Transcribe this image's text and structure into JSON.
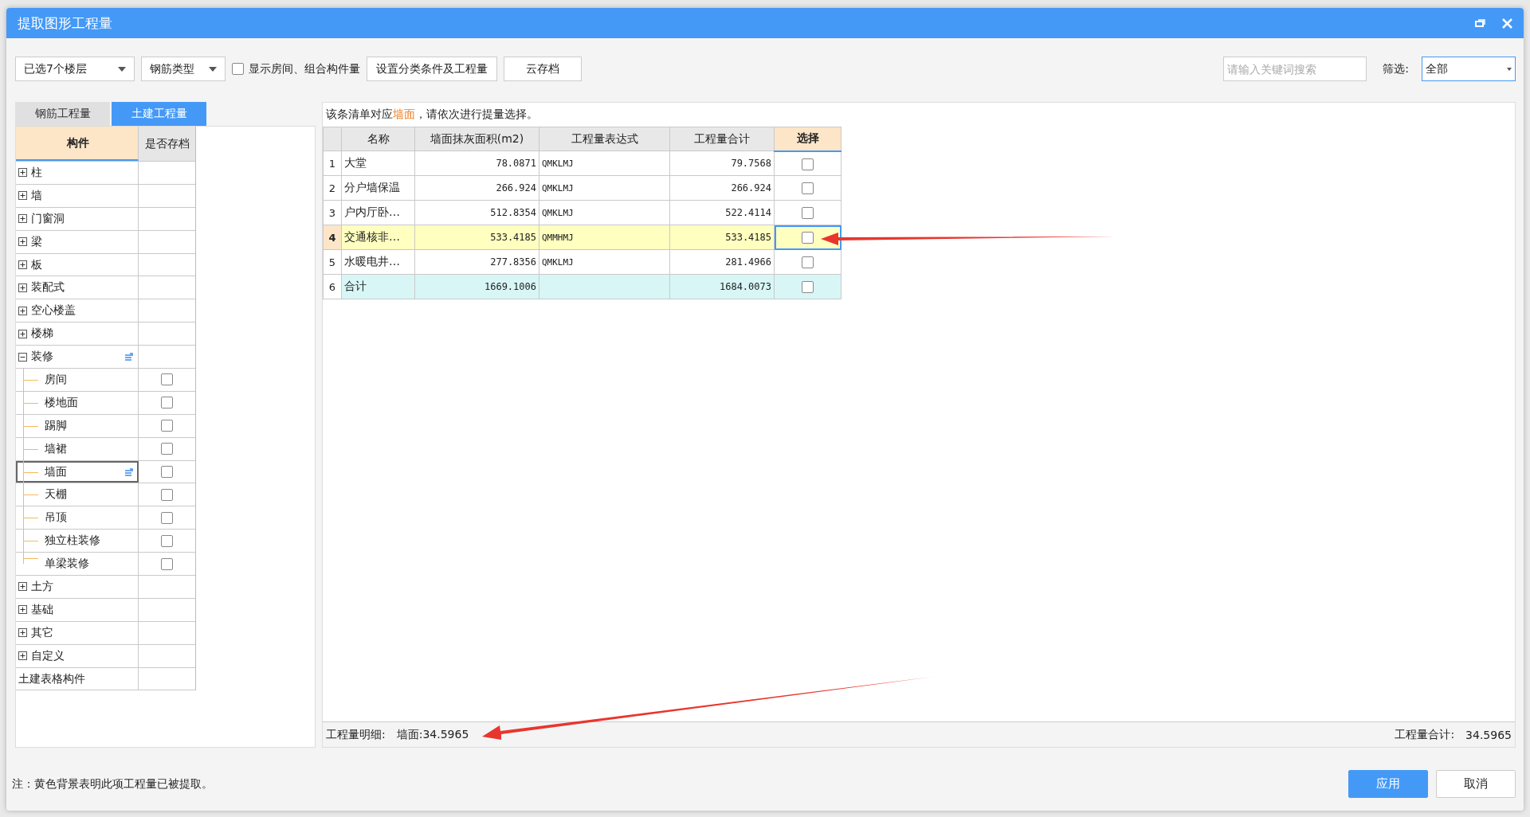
{
  "window": {
    "title": "提取图形工程量"
  },
  "toolbar": {
    "floors": "已选7个楼层",
    "rebar_type": "钢筋类型",
    "show_rooms": {
      "label": "显示房间、组合构件量",
      "checked": false
    },
    "buttons": [
      "设置分类条件及工程量",
      "云存档"
    ],
    "search": {
      "placeholder": "请输入关键词搜索"
    },
    "filter": {
      "label": "筛选:",
      "value": "全部"
    }
  },
  "tabs": [
    {
      "label": "钢筋工程量",
      "selected": false
    },
    {
      "label": "土建工程量",
      "selected": true
    }
  ],
  "tree": {
    "columns": [
      "构件",
      "是否存档"
    ],
    "items": [
      {
        "label": "柱",
        "kind": "group",
        "expanded": false,
        "selected": false
      },
      {
        "label": "墙",
        "kind": "group",
        "expanded": false,
        "selected": false
      },
      {
        "label": "门窗洞",
        "kind": "group",
        "expanded": false,
        "selected": false
      },
      {
        "label": "梁",
        "kind": "group",
        "expanded": false,
        "selected": false
      },
      {
        "label": "板",
        "kind": "group",
        "expanded": false,
        "selected": false
      },
      {
        "label": "装配式",
        "kind": "group",
        "expanded": false,
        "selected": false
      },
      {
        "label": "空心楼盖",
        "kind": "group",
        "expanded": false,
        "selected": false
      },
      {
        "label": "楼梯",
        "kind": "group",
        "expanded": false,
        "selected": false
      },
      {
        "label": "装修",
        "kind": "group",
        "expanded": true,
        "selected": false,
        "marked": true,
        "children": [
          {
            "label": "房间",
            "checked": false,
            "selected": false,
            "marked": false
          },
          {
            "label": "楼地面",
            "checked": false,
            "selected": false,
            "marked": false
          },
          {
            "label": "踢脚",
            "checked": false,
            "selected": false,
            "marked": false
          },
          {
            "label": "墙裙",
            "checked": false,
            "selected": false,
            "marked": false
          },
          {
            "label": "墙面",
            "checked": false,
            "selected": true,
            "marked": true
          },
          {
            "label": "天棚",
            "checked": false,
            "selected": false,
            "marked": false
          },
          {
            "label": "吊顶",
            "checked": false,
            "selected": false,
            "marked": false
          },
          {
            "label": "独立柱装修",
            "checked": false,
            "selected": false,
            "marked": false
          },
          {
            "label": "单梁装修",
            "checked": false,
            "selected": false,
            "marked": false
          }
        ]
      },
      {
        "label": "土方",
        "kind": "group",
        "expanded": false,
        "selected": false
      },
      {
        "label": "基础",
        "kind": "group",
        "expanded": false,
        "selected": false
      },
      {
        "label": "其它",
        "kind": "group",
        "expanded": false,
        "selected": false
      },
      {
        "label": "自定义",
        "kind": "group",
        "expanded": false,
        "selected": false
      },
      {
        "label": "土建表格构件",
        "kind": "plain",
        "selected": false
      }
    ]
  },
  "notice": "该条清单对应**墙面**，请依次进行提量选择。",
  "table": {
    "columns": [
      {
        "label": "名称",
        "active": false
      },
      {
        "label": "墙面抹灰面积(m2)",
        "active": false
      },
      {
        "label": "工程量表达式",
        "active": false
      },
      {
        "label": "工程量合计",
        "active": false
      },
      {
        "label": "选择",
        "active": true
      }
    ],
    "rows": [
      {
        "index": "1",
        "name": "大堂",
        "area": "78.0871",
        "expression": "QMKLMJ",
        "total": "79.7568",
        "checked": false,
        "extracted": false,
        "current": false,
        "kind": "item"
      },
      {
        "index": "2",
        "name": "分户墙保温",
        "area": "266.924",
        "expression": "QMKLMJ",
        "total": "266.924",
        "checked": false,
        "extracted": false,
        "current": false,
        "kind": "item"
      },
      {
        "index": "3",
        "name": "户内厅卧…",
        "area": "512.8354",
        "expression": "QMKLMJ",
        "total": "522.4114",
        "checked": false,
        "extracted": false,
        "current": false,
        "kind": "item"
      },
      {
        "index": "4",
        "name": "交通核非…",
        "area": "533.4185",
        "expression": "QMMHMJ",
        "total": "533.4185",
        "checked": false,
        "extracted": true,
        "current": true,
        "kind": "item"
      },
      {
        "index": "5",
        "name": "水暖电井…",
        "area": "277.8356",
        "expression": "QMKLMJ",
        "total": "281.4966",
        "checked": false,
        "extracted": false,
        "current": false,
        "kind": "item"
      },
      {
        "index": "6",
        "name": "合计",
        "area": "1669.1006",
        "total": "1684.0073",
        "checked": false,
        "extracted": false,
        "current": false,
        "kind": "total"
      }
    ]
  },
  "detail": {
    "label": "工程量明细:",
    "value": "墙面:34.5965"
  },
  "sum": {
    "label": "工程量合计:",
    "value": "34.5965"
  },
  "note": "注：黄色背景表明此项工程量已被提取。",
  "buttons": [
    {
      "label": "应用",
      "kind": "primary"
    },
    {
      "label": "取消",
      "kind": "secondary"
    }
  ]
}
